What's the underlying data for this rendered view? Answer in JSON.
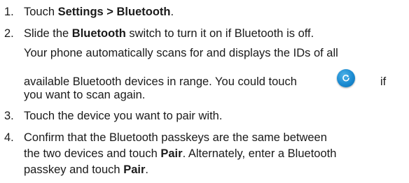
{
  "steps": [
    {
      "number": "1.",
      "lines": [
        [
          {
            "t": "Touch "
          },
          {
            "t": "Settings > Bluetooth",
            "b": true
          },
          {
            "t": "."
          }
        ]
      ]
    },
    {
      "number": "2.",
      "lines": [
        [
          {
            "t": "Slide the "
          },
          {
            "t": "Bluetooth",
            "b": true
          },
          {
            "t": " switch to turn it on if Bluetooth is off."
          }
        ],
        [
          {
            "t": "Your phone automatically scans for and displays the IDs of all"
          }
        ],
        [
          {
            "t": "available Bluetooth devices in range. You could touch "
          },
          {
            "icon": "refresh-icon"
          },
          {
            "t": " if"
          }
        ],
        [
          {
            "t": "you want to scan again."
          }
        ]
      ]
    },
    {
      "number": "3.",
      "lines": [
        [
          {
            "t": "Touch the device you want to pair with."
          }
        ]
      ]
    },
    {
      "number": "4.",
      "lines": [
        [
          {
            "t": "Confirm that the Bluetooth passkeys are the same between"
          }
        ],
        [
          {
            "t": "the two devices and touch "
          },
          {
            "t": "Pair",
            "b": true
          },
          {
            "t": ". Alternately, enter a Bluetooth"
          }
        ],
        [
          {
            "t": "passkey and touch "
          },
          {
            "t": "Pair",
            "b": true
          },
          {
            "t": "."
          }
        ]
      ]
    }
  ],
  "icons": {
    "scan_button_color": "#1a8ad1"
  }
}
